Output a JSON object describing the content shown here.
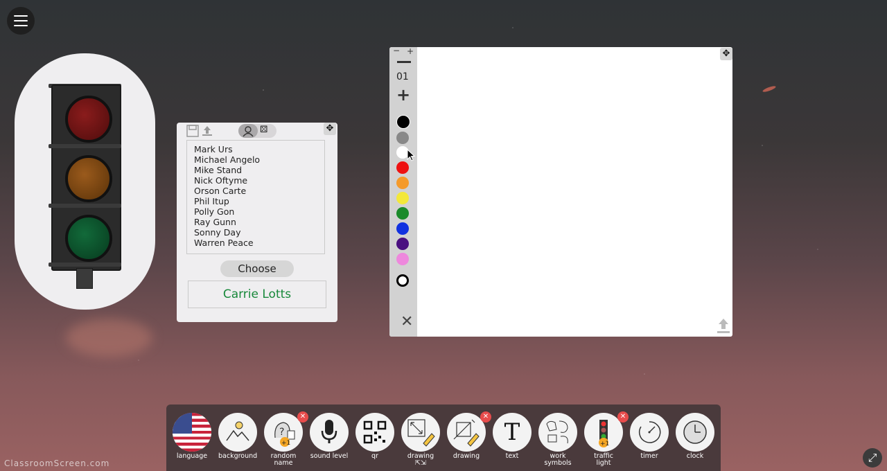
{
  "widgets": {
    "random_name": {
      "names": [
        "Mark Urs",
        "Michael Angelo",
        "Mike Stand",
        "Nick Oftyme",
        "Orson Carte",
        "Phil Itup",
        "Polly Gon",
        "Ray Gunn",
        "Sonny Day",
        "Warren Peace"
      ],
      "choose_label": "Choose",
      "result": "Carrie Lotts"
    },
    "drawing": {
      "line_width": "01",
      "tiny_minus": "−",
      "tiny_plus": "+",
      "colors": [
        "#000000",
        "#888888",
        "#ffffff",
        "#ee1111",
        "#f59a2a",
        "#f3e83a",
        "#1a8a2a",
        "#1131e0",
        "#4a1080",
        "#ee88dd"
      ]
    }
  },
  "toolbar": {
    "tools": [
      {
        "label": "language",
        "icon": "us-flag-icon"
      },
      {
        "label": "background",
        "icon": "landscape-icon"
      },
      {
        "label": "random\nname",
        "icon": "random-name-icon",
        "badge": "✕"
      },
      {
        "label": "sound level",
        "icon": "microphone-icon"
      },
      {
        "label": "qr",
        "icon": "qr-code-icon"
      },
      {
        "label": "drawing\n⇱⇲",
        "icon": "drawing-expand-icon"
      },
      {
        "label": "drawing",
        "icon": "drawing-icon",
        "badge": "✕"
      },
      {
        "label": "text",
        "icon": "text-icon"
      },
      {
        "label": "work\nsymbols",
        "icon": "work-symbols-icon"
      },
      {
        "label": "traffic\nlight",
        "icon": "traffic-light-icon",
        "badge": "✕"
      },
      {
        "label": "timer",
        "icon": "timer-icon"
      },
      {
        "label": "clock",
        "icon": "clock-icon"
      }
    ]
  },
  "brand": "ClassroomScreen.com"
}
